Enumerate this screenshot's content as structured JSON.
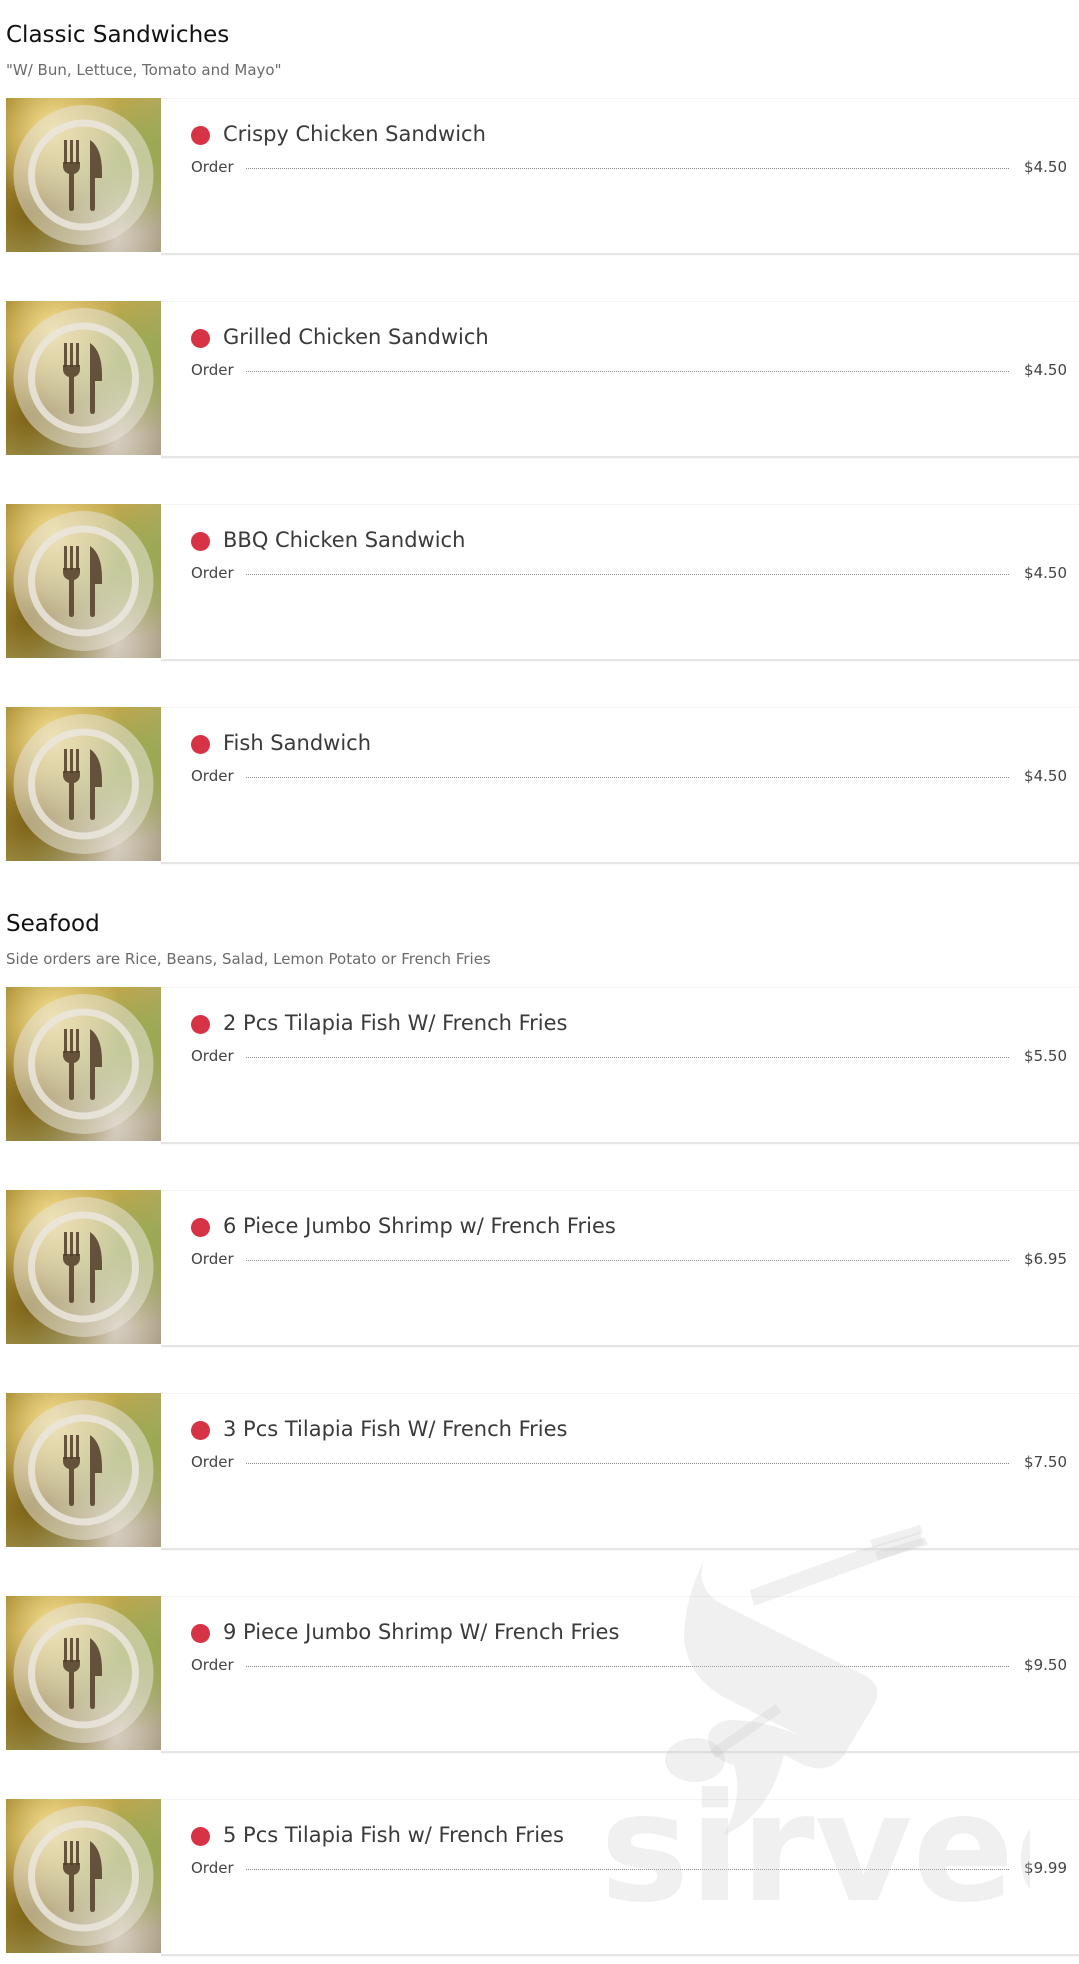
{
  "sections": [
    {
      "title": "Classic Sandwiches",
      "description": "\"W/ Bun, Lettuce, Tomato and Mayo\"",
      "items": [
        {
          "name": "Crispy Chicken Sandwich",
          "order_label": "Order",
          "price": "$4.50"
        },
        {
          "name": "Grilled Chicken Sandwich",
          "order_label": "Order",
          "price": "$4.50"
        },
        {
          "name": "BBQ Chicken Sandwich",
          "order_label": "Order",
          "price": "$4.50"
        },
        {
          "name": "Fish Sandwich",
          "order_label": "Order",
          "price": "$4.50"
        }
      ]
    },
    {
      "title": "Seafood",
      "description": "Side orders are Rice, Beans, Salad, Lemon Potato or French Fries",
      "items": [
        {
          "name": "2 Pcs Tilapia Fish W/ French Fries",
          "order_label": "Order",
          "price": "$5.50"
        },
        {
          "name": "6 Piece Jumbo Shrimp w/ French Fries",
          "order_label": "Order",
          "price": "$6.95"
        },
        {
          "name": "3 Pcs Tilapia Fish W/ French Fries",
          "order_label": "Order",
          "price": "$7.50"
        },
        {
          "name": "9 Piece Jumbo Shrimp W/ French Fries",
          "order_label": "Order",
          "price": "$9.50"
        },
        {
          "name": "5 Pcs Tilapia Fish w/ French Fries",
          "order_label": "Order",
          "price": "$9.99"
        }
      ]
    }
  ],
  "watermark": {
    "text": "sirved",
    "icon": "sirved-logo-icon"
  },
  "colors": {
    "bullet": "#d63446",
    "text": "#3a3a3a",
    "muted": "#6b6b6b"
  },
  "icons": {
    "thumbnail": "fork-knife-plate-icon"
  }
}
